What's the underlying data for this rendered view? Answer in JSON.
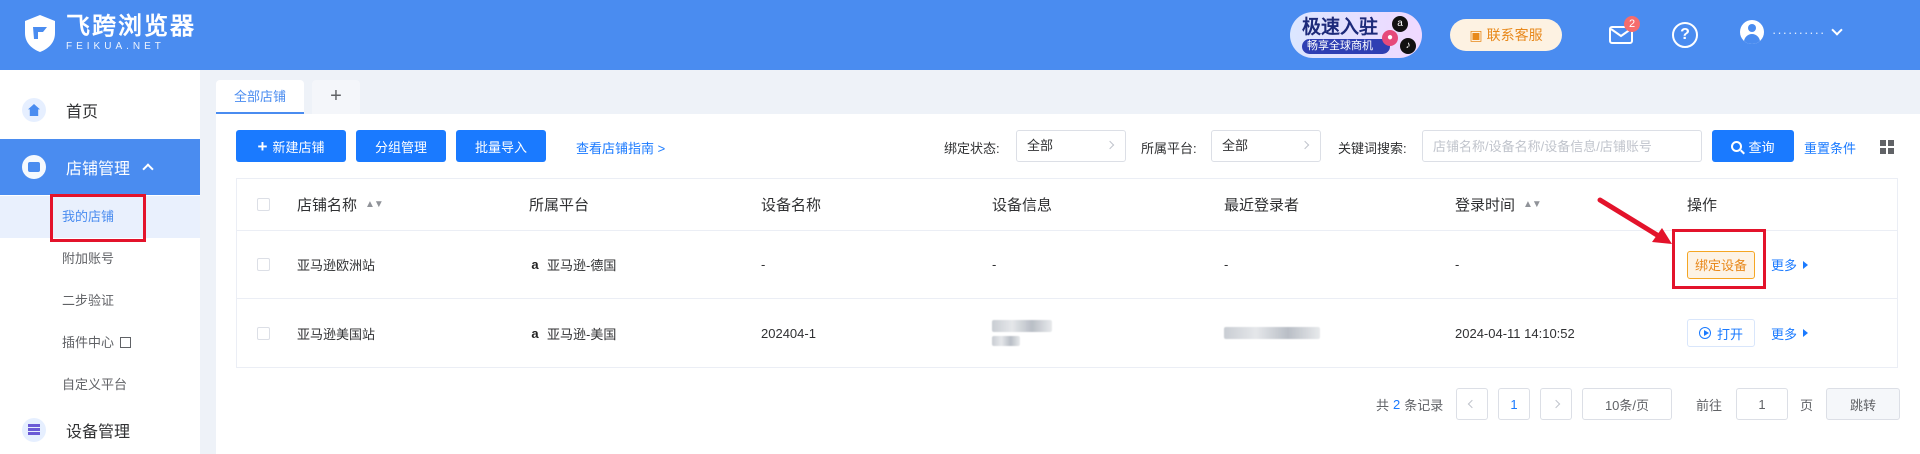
{
  "header": {
    "logo_title": "飞跨浏览器",
    "logo_sub": "FEIKUA.NET",
    "promo_main": "极速入驻",
    "promo_sub": "畅享全球商机",
    "contact_label": "联系客服",
    "mail_badge": "2",
    "help_label": "?",
    "user_name": "··········"
  },
  "sidebar": {
    "items": [
      {
        "label": "首页",
        "icon": "home-icon"
      },
      {
        "label": "店铺管理",
        "icon": "store-icon"
      },
      {
        "label": "设备管理",
        "icon": "device-icon"
      }
    ],
    "sub_items": [
      {
        "label": "我的店铺"
      },
      {
        "label": "附加账号"
      },
      {
        "label": "二步验证"
      },
      {
        "label": "插件中心"
      },
      {
        "label": "自定义平台"
      }
    ]
  },
  "tabs": [
    {
      "label": "全部店铺"
    },
    {
      "label": "+"
    }
  ],
  "toolbar": {
    "new_store": "新建店铺",
    "group_manage": "分组管理",
    "batch_import": "批量导入",
    "guide_link": "查看店铺指南 >",
    "bind_status_label": "绑定状态:",
    "bind_status_value": "全部",
    "platform_label": "所属平台:",
    "platform_value": "全部",
    "keyword_label": "关键词搜索:",
    "keyword_placeholder": "店铺名称/设备名称/设备信息/店铺账号",
    "query_btn": "查询",
    "reset_link": "重置条件"
  },
  "table": {
    "headers": [
      "店铺名称",
      "所属平台",
      "设备名称",
      "设备信息",
      "最近登录者",
      "登录时间",
      "操作"
    ],
    "rows": [
      {
        "store_name": "亚马逊欧洲站",
        "platform": "亚马逊-德国",
        "device_name": "-",
        "device_info": "-",
        "last_login_user": "-",
        "login_time": "-",
        "action": "绑定设备",
        "more": "更多"
      },
      {
        "store_name": "亚马逊美国站",
        "platform": "亚马逊-美国",
        "device_name": "202404-1",
        "device_info": "",
        "last_login_user": "",
        "login_time": "2024-04-11 14:10:52",
        "action": "打开",
        "more": "更多"
      }
    ]
  },
  "pagination": {
    "total_prefix": "共",
    "total_count": "2",
    "total_suffix": "条记录",
    "current_page": "1",
    "page_size": "10条/页",
    "goto_label": "前往",
    "goto_value": "1",
    "page_unit": "页",
    "jump_btn": "跳转"
  },
  "colors": {
    "brand": "#4a8cf0",
    "primary_button": "#1a7aff",
    "warning": "#e8891c",
    "annotation": "#e3132b"
  }
}
